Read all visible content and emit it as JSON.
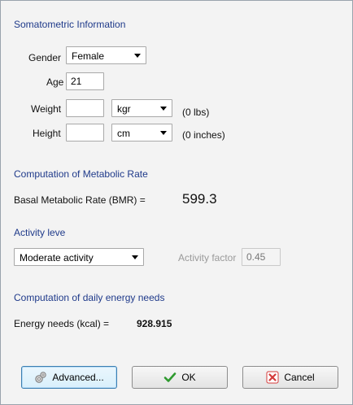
{
  "sections": {
    "somatometric": "Somatometric Information",
    "metabolic": "Computation of Metabolic Rate",
    "activity": "Activity leve",
    "energy": "Computation of daily energy needs"
  },
  "gender": {
    "label": "Gender",
    "value": "Female"
  },
  "age": {
    "label": "Age",
    "value": "21"
  },
  "weight": {
    "label": "Weight",
    "value": "",
    "unit": "kgr",
    "converted": "(0 lbs)"
  },
  "height": {
    "label": "Height",
    "value": "",
    "unit": "cm",
    "converted": "(0 inches)"
  },
  "bmr": {
    "label": "Basal Metabolic Rate (BMR) =",
    "value": "599.3"
  },
  "activity": {
    "value": "Moderate activity",
    "factor_label": "Activity factor",
    "factor_value": "0.45"
  },
  "energy": {
    "label": "Energy needs (kcal) =",
    "value": "928.915"
  },
  "buttons": {
    "advanced": "Advanced...",
    "ok": "OK",
    "cancel": "Cancel"
  },
  "colors": {
    "section_text": "#1f3a8a",
    "ok_icon": "#2e9a2e",
    "cancel_icon": "#d43a3a"
  },
  "icons": {
    "advanced": "gears-icon",
    "ok": "checkmark-icon",
    "cancel": "x-icon"
  }
}
